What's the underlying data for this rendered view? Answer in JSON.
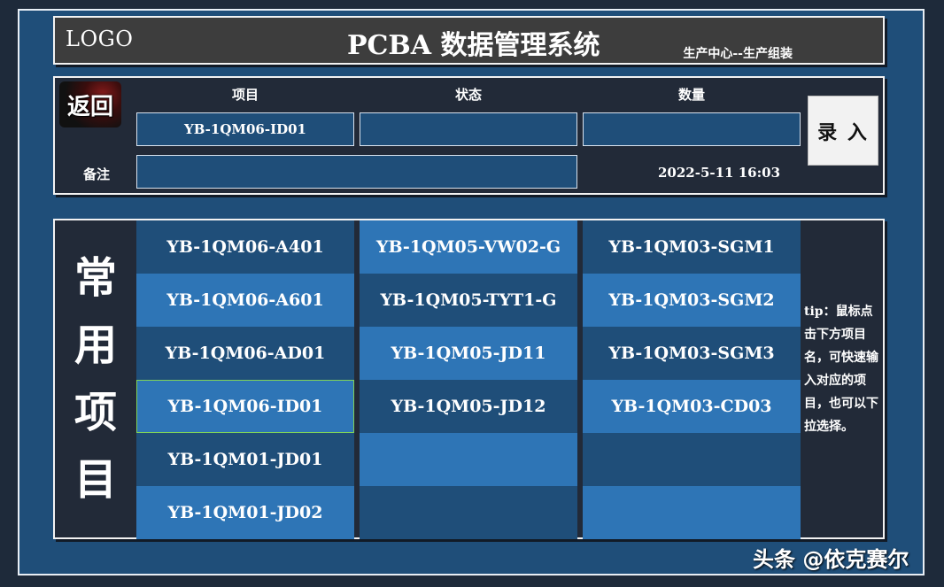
{
  "header": {
    "logo": "LOGO",
    "title": "PCBA 数据管理系统",
    "subtitle": "生产中心--生产组装"
  },
  "entry": {
    "back_label": "返回",
    "columns": [
      "项目",
      "状态",
      "数量"
    ],
    "project_value": "YB-1QM06-ID01",
    "status_value": "",
    "quantity_value": "",
    "note_label": "备注",
    "note_value": "",
    "timestamp": "2022-5-11 16:03",
    "submit_label": "录 入"
  },
  "common": {
    "side_title": [
      "常",
      "用",
      "项",
      "目"
    ],
    "selected": "YB-1QM06-ID01",
    "columns": [
      [
        "YB-1QM06-A401",
        "YB-1QM06-A601",
        "YB-1QM06-AD01",
        "YB-1QM06-ID01",
        "YB-1QM01-JD01",
        "YB-1QM01-JD02"
      ],
      [
        "YB-1QM05-VW02-G",
        "YB-1QM05-TYT1-G",
        "YB-1QM05-JD11",
        "YB-1QM05-JD12",
        "",
        ""
      ],
      [
        "YB-1QM03-SGM1",
        "YB-1QM03-SGM2",
        "YB-1QM03-SGM3",
        "YB-1QM03-CD03",
        "",
        ""
      ]
    ],
    "tip": "tip：鼠标点击下方项目名，可快速输入对应的项目，也可以下拉选择。"
  },
  "watermark": "头条 @依克赛尔",
  "colors": {
    "background": "#1f4e79",
    "cell_dark": "#1f4e79",
    "cell_light": "#2e75b6",
    "panel": "#222a38",
    "header": "#3d3d3d",
    "selected_border": "#7fd35a"
  }
}
